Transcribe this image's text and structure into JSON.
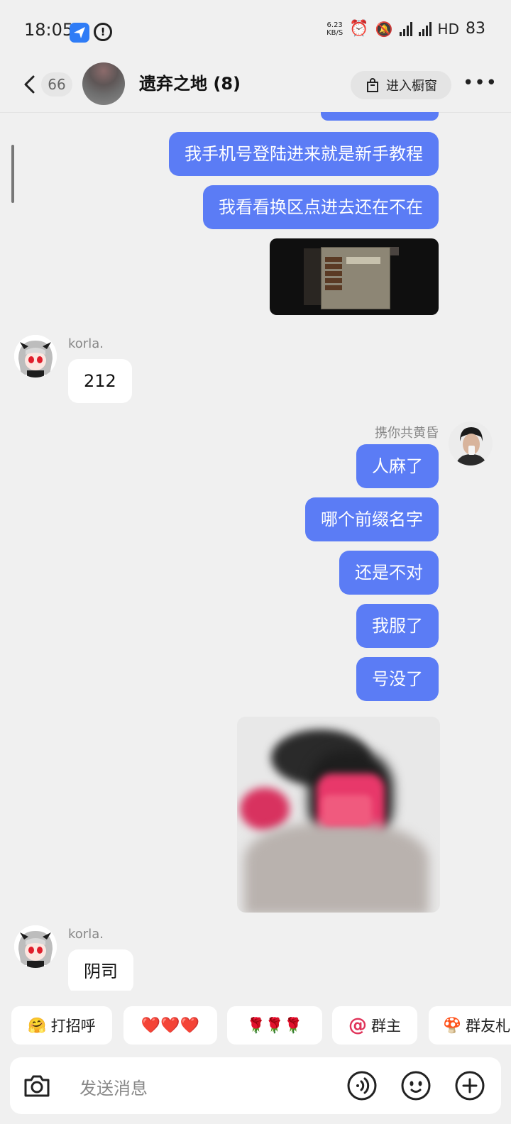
{
  "status": {
    "time": "18:05",
    "speed_value": "6.23",
    "speed_unit": "KB/S",
    "hd": "HD",
    "battery": "83"
  },
  "header": {
    "back_count": "66",
    "title": "遗弃之地 (8)",
    "shop_label": "进入橱窗"
  },
  "messages": {
    "m1": "我手机号登陆进来就是新手教程",
    "m2": "我看看换区点进去还在不在",
    "korla_name": "korla.",
    "korla_msg1": "212",
    "me_name": "携你共黄昏",
    "m3": "人麻了",
    "m4": "哪个前缀名字",
    "m5": "还是不对",
    "m6": "我服了",
    "m7": "号没了",
    "korla_name2": "korla.",
    "korla_msg2": "阴司"
  },
  "quick_replies": [
    {
      "label": "打招呼",
      "icon": "wave-emoji"
    },
    {
      "label": "❤️❤️❤️"
    },
    {
      "label": "🌹🌹🌹"
    },
    {
      "label": "群主",
      "icon": "at-icon"
    },
    {
      "label": "群友札",
      "icon": "cloud-emoji"
    }
  ],
  "input": {
    "placeholder": "发送消息"
  },
  "colors": {
    "accent": "#5b7cf5",
    "background": "#f0f0f0",
    "at_red": "#e0345a"
  }
}
